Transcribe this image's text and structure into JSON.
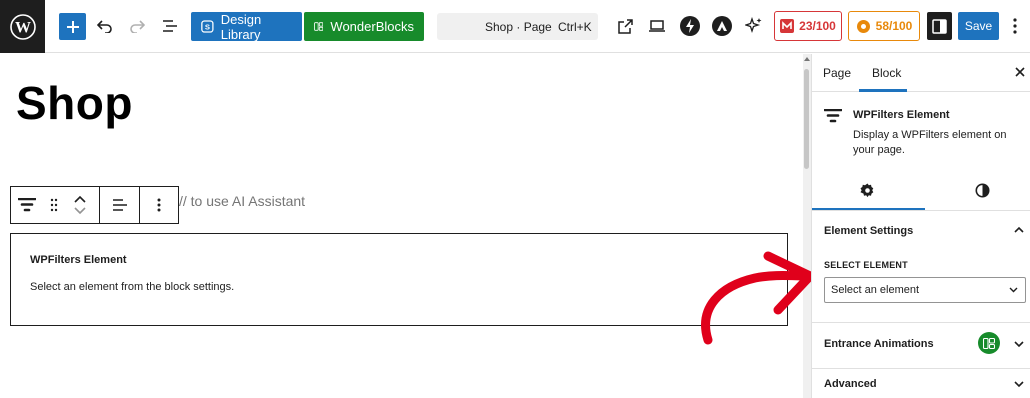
{
  "toolbar": {
    "design_library_label": "Design Library",
    "wonderblocks_label": "WonderBlocks",
    "document_title": "Shop · Page",
    "shortcut": "Ctrl+K",
    "seo_score": "23/100",
    "readability_score": "58/100",
    "save_label": "Save"
  },
  "canvas": {
    "page_title": "Shop",
    "ai_hint": "// to use AI Assistant",
    "block": {
      "title": "WPFilters Element",
      "description": "Select an element from the block settings."
    }
  },
  "sidebar": {
    "tabs": [
      "Page",
      "Block"
    ],
    "active_tab": "Block",
    "block_card": {
      "name": "WPFilters Element",
      "description": "Display a WPFilters element on your page."
    },
    "element_settings": {
      "heading": "Element Settings",
      "select_label": "SELECT ELEMENT",
      "select_value": "Select an element"
    },
    "entrance_animations": "Entrance Animations",
    "advanced": "Advanced"
  },
  "colors": {
    "accent": "#1e73be",
    "green": "#178b2b",
    "score_red": "#d63638",
    "score_orange": "#e8890b",
    "annotation_arrow": "#e0001b"
  }
}
